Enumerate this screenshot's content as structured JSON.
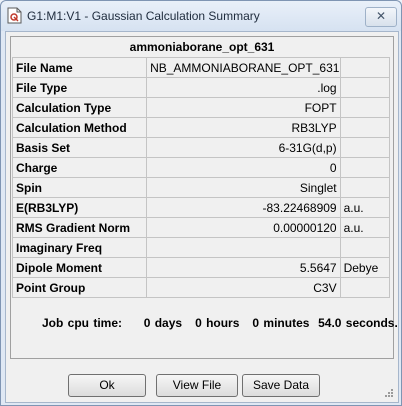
{
  "window": {
    "title": "G1:M1:V1 - Gaussian Calculation Summary",
    "close_symbol": "✕"
  },
  "summary": {
    "job_name": "ammoniaborane_opt_631",
    "rows": [
      {
        "label": "File Name",
        "value": "NB_AMMONIABORANE_OPT_631G",
        "unit": ""
      },
      {
        "label": "File Type",
        "value": ".log",
        "unit": ""
      },
      {
        "label": "Calculation Type",
        "value": "FOPT",
        "unit": ""
      },
      {
        "label": "Calculation Method",
        "value": "RB3LYP",
        "unit": ""
      },
      {
        "label": "Basis Set",
        "value": "6-31G(d,p)",
        "unit": ""
      },
      {
        "label": "Charge",
        "value": "0",
        "unit": ""
      },
      {
        "label": "Spin",
        "value": "Singlet",
        "unit": ""
      },
      {
        "label": "E(RB3LYP)",
        "value": "-83.22468909",
        "unit": "a.u."
      },
      {
        "label": "RMS Gradient Norm",
        "value": "0.00000120",
        "unit": "a.u."
      },
      {
        "label": "Imaginary Freq",
        "value": "",
        "unit": ""
      },
      {
        "label": "Dipole Moment",
        "value": "5.5647",
        "unit": "Debye"
      },
      {
        "label": "Point Group",
        "value": "C3V",
        "unit": ""
      }
    ],
    "cpu": {
      "label": "Job cpu time:",
      "days": "0 days",
      "hours": "0 hours",
      "minutes": "0 minutes",
      "seconds": "54.0 seconds."
    }
  },
  "buttons": {
    "ok": "Ok",
    "view_file": "View File",
    "save_data": "Save Data"
  },
  "icons": {
    "app": "gaussview-document-icon",
    "close": "close-icon",
    "grip": "resize-grip-icon"
  }
}
